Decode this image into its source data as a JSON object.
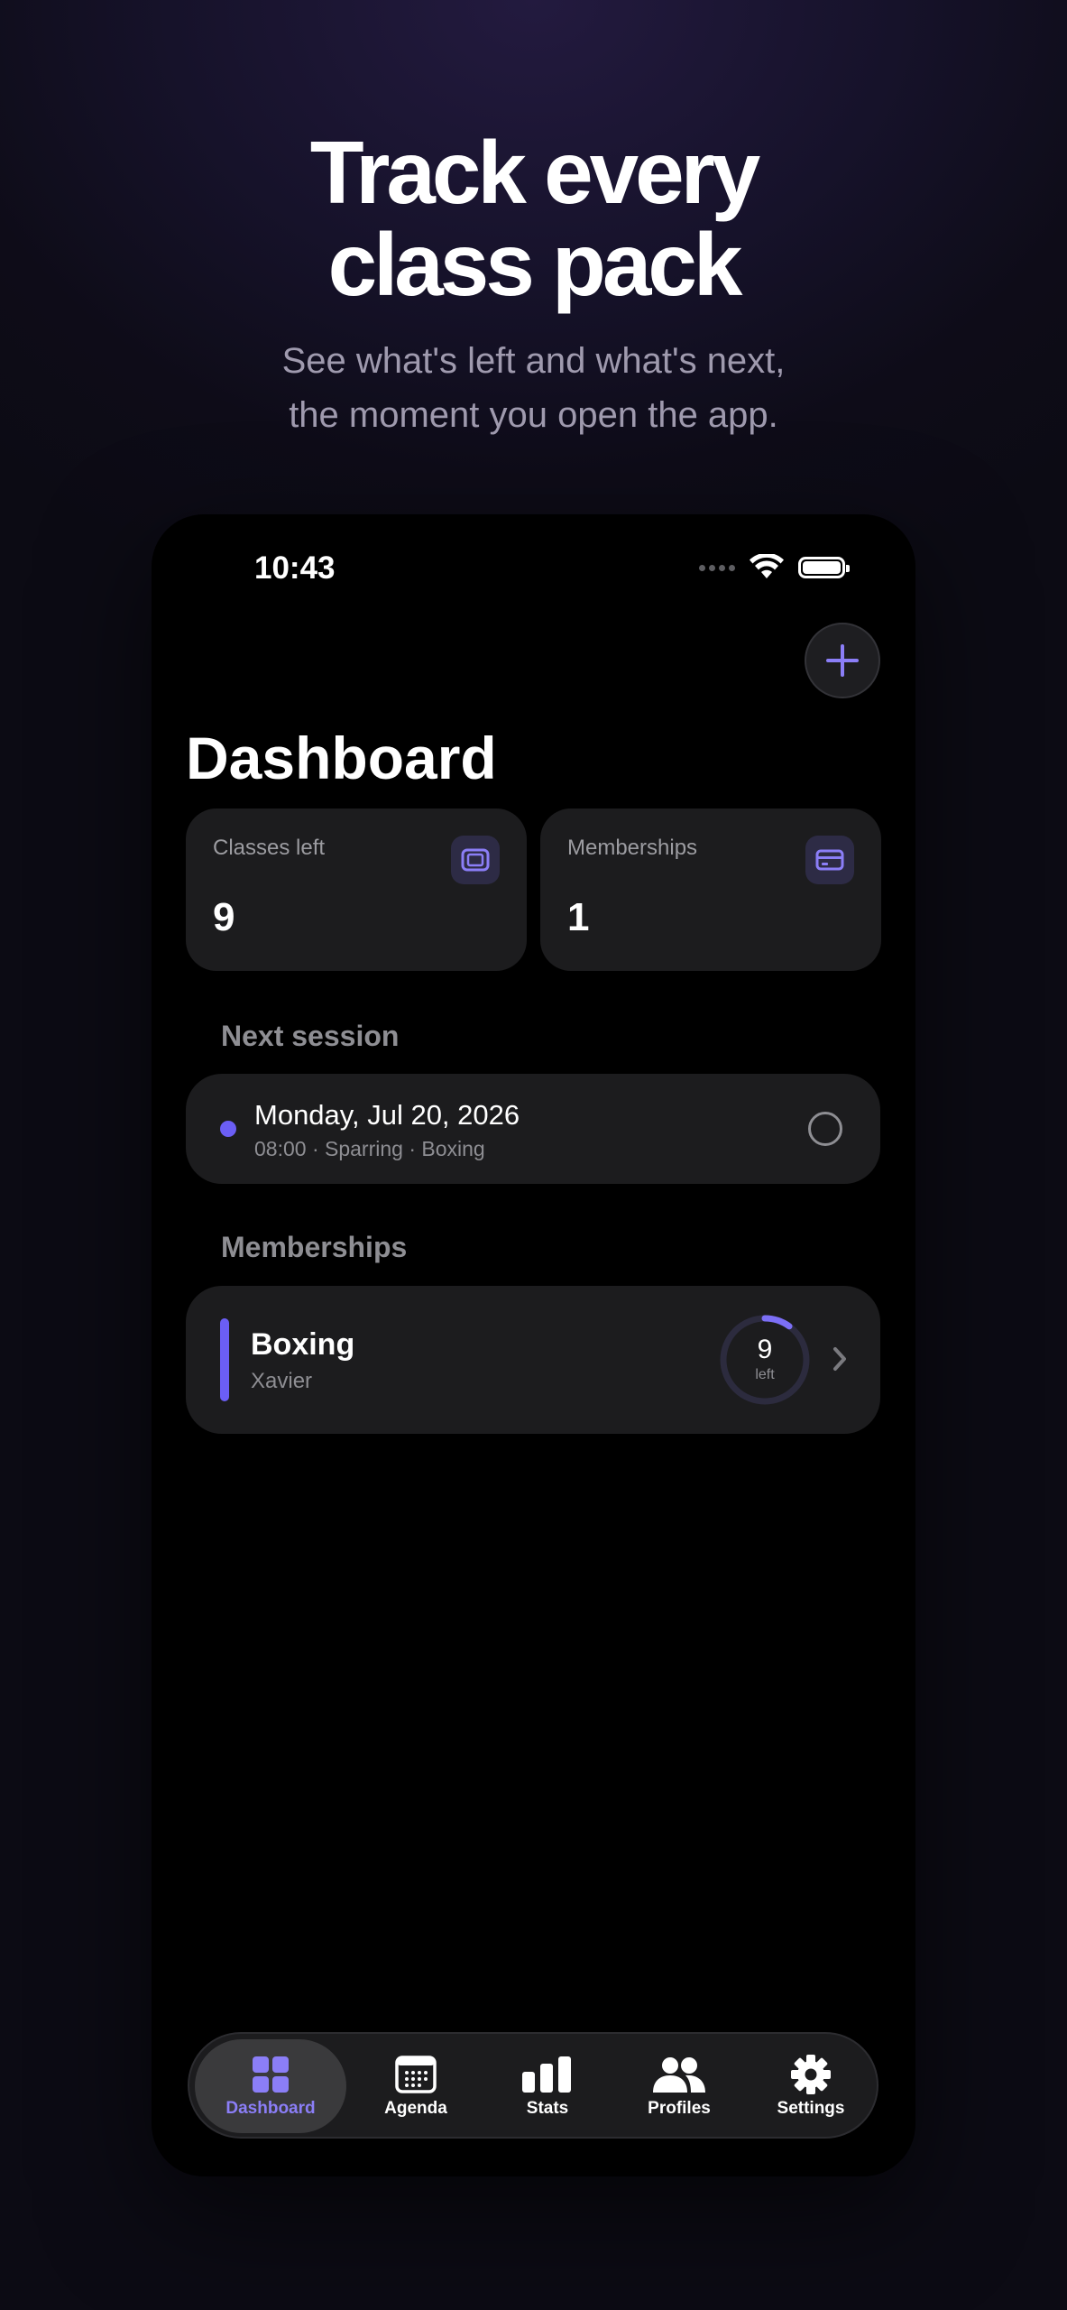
{
  "promo": {
    "headline_line1": "Track every",
    "headline_line2": "class pack",
    "subline_line1": "See what's left and what's next,",
    "subline_line2": "the moment you open the app."
  },
  "status_bar": {
    "time": "10:43"
  },
  "header": {
    "title": "Dashboard",
    "add_icon": "plus-icon"
  },
  "stats": [
    {
      "label": "Classes left",
      "value": "9",
      "icon": "ticket-icon"
    },
    {
      "label": "Memberships",
      "value": "1",
      "icon": "card-icon"
    }
  ],
  "next_session": {
    "section_label": "Next session",
    "date": "Monday, Jul 20, 2026",
    "meta": "08:00  · Sparring  · Boxing"
  },
  "memberships": {
    "section_label": "Memberships",
    "items": [
      {
        "name": "Boxing",
        "owner": "Xavier",
        "remaining": "9",
        "remaining_label": "left",
        "progress_fraction": 0.1
      }
    ]
  },
  "tabbar": {
    "items": [
      {
        "label": "Dashboard",
        "icon": "grid-icon",
        "active": true
      },
      {
        "label": "Agenda",
        "icon": "calendar-icon",
        "active": false
      },
      {
        "label": "Stats",
        "icon": "bar-chart-icon",
        "active": false
      },
      {
        "label": "Profiles",
        "icon": "people-icon",
        "active": false
      },
      {
        "label": "Settings",
        "icon": "gear-icon",
        "active": false
      }
    ]
  },
  "colors": {
    "accent": "#6b5ef5",
    "accent_light": "#8b7ef7",
    "card": "#1c1c1e"
  }
}
